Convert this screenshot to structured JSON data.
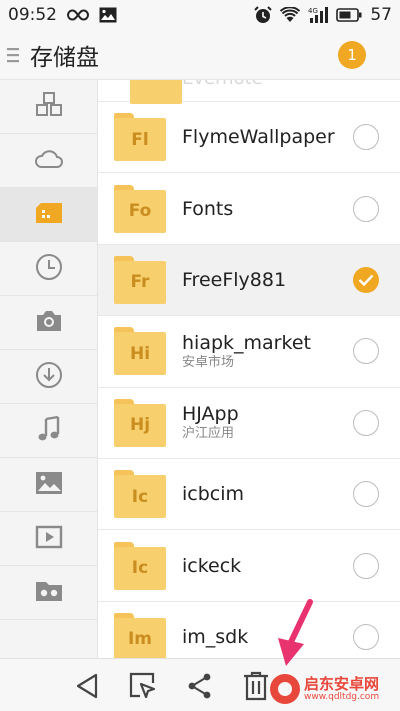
{
  "status_bar": {
    "time": "09:52",
    "battery": "57",
    "icons": [
      "infinity-icon",
      "gallery-icon",
      "alarm-icon",
      "wifi-icon",
      "4g-signal-icon",
      "battery-icon"
    ]
  },
  "header": {
    "title": "存储盘",
    "badge": "1"
  },
  "sidebar": {
    "items": [
      {
        "icon": "apps-icon"
      },
      {
        "icon": "cloud-icon"
      },
      {
        "icon": "sd-card-icon",
        "active": true
      },
      {
        "icon": "clock-icon"
      },
      {
        "icon": "camera-icon"
      },
      {
        "icon": "download-icon"
      },
      {
        "icon": "music-icon"
      },
      {
        "icon": "image-icon"
      },
      {
        "icon": "video-icon"
      },
      {
        "icon": "vr-folder-icon"
      }
    ]
  },
  "files": {
    "partial": {
      "abbr": "",
      "name": "Evernote"
    },
    "rows": [
      {
        "abbr": "Fl",
        "name": "FlymeWallpaper",
        "sub": "",
        "checked": false
      },
      {
        "abbr": "Fo",
        "name": "Fonts",
        "sub": "",
        "checked": false
      },
      {
        "abbr": "Fr",
        "name": "FreeFly881",
        "sub": "",
        "checked": true
      },
      {
        "abbr": "Hi",
        "name": "hiapk_market",
        "sub": "安卓市场",
        "checked": false
      },
      {
        "abbr": "Hj",
        "name": "HJApp",
        "sub": "沪江应用",
        "checked": false
      },
      {
        "abbr": "Ic",
        "name": "icbcim",
        "sub": "",
        "checked": false
      },
      {
        "abbr": "Ic",
        "name": "ickeck",
        "sub": "",
        "checked": false
      },
      {
        "abbr": "Im",
        "name": "im_sdk",
        "sub": "",
        "checked": false
      }
    ]
  },
  "toolbar": {
    "buttons": [
      "back-icon",
      "select-icon",
      "share-icon",
      "delete-icon"
    ]
  },
  "watermark": {
    "cn": "启东安卓网",
    "url": "www.qdltdg.com"
  },
  "colors": {
    "accent": "#f0a722",
    "folder": "#f8cf6d",
    "folder_text": "#c98d20",
    "watermark": "#e8483c",
    "arrow": "#e8336f"
  }
}
